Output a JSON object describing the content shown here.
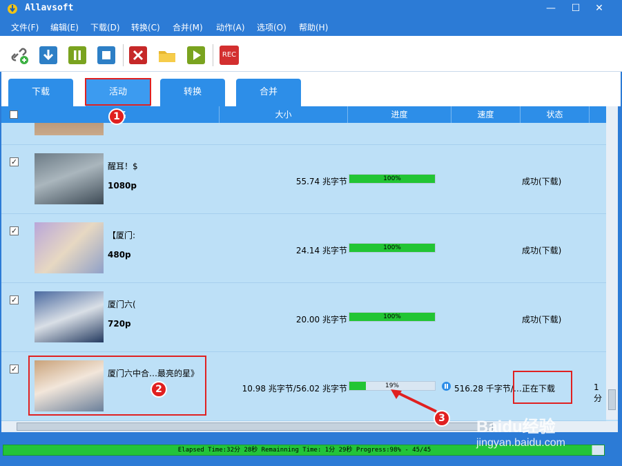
{
  "window": {
    "title": "Allavsoft",
    "minimize": "—",
    "maximize": "☐",
    "close": "✕"
  },
  "menu": [
    "文件(F)",
    "编辑(E)",
    "下载(D)",
    "转换(C)",
    "合并(M)",
    "动作(A)",
    "选项(O)",
    "帮助(H)"
  ],
  "toolbar": {
    "rec_label": "REC"
  },
  "tabs": [
    "下载",
    "活动",
    "转换",
    "合并"
  ],
  "active_tab": "活动",
  "columns": {
    "name": "名",
    "size": "大小",
    "progress": "进度",
    "speed": "速度",
    "status": "状态"
  },
  "rows": [
    {
      "name": "醒耳！$",
      "resolution": "1080p",
      "size": "55.74 兆字节",
      "progress": 100,
      "progress_label": "100%",
      "speed": "",
      "status": "成功(下载)"
    },
    {
      "name": "【厦门:",
      "resolution": "480p",
      "size": "24.14 兆字节",
      "progress": 100,
      "progress_label": "100%",
      "speed": "",
      "status": "成功(下载)"
    },
    {
      "name": "厦门六(",
      "resolution": "720p",
      "size": "20.00 兆字节",
      "progress": 100,
      "progress_label": "100%",
      "speed": "",
      "status": "成功(下载)"
    },
    {
      "name": "厦门六中合…最亮的星》",
      "resolution": "",
      "size": "10.98 兆字节/56.02 兆字节",
      "progress": 19,
      "progress_label": "19%",
      "speed": "516.28 千字节/…",
      "status": "正在下载",
      "extra": "1分"
    }
  ],
  "statusbar": {
    "text": "Elapsed Time:32分 28秒 Remainning Time: 1分 29秒 Progress:98% - 45/45",
    "progress": 98
  },
  "annotations": [
    "1",
    "2",
    "3"
  ],
  "watermark": {
    "brand": "Baidu经验",
    "url": "jingyan.baidu.com"
  },
  "colors": {
    "accent": "#2d8ee8",
    "row_bg": "#bde0f7",
    "progress_green": "#22c534",
    "annotation_red": "#e02020"
  }
}
